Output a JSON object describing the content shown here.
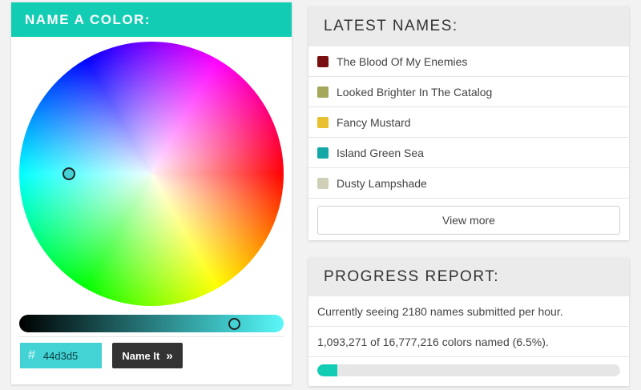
{
  "color_picker": {
    "title": "NAME A COLOR:",
    "hex_symbol": "#",
    "hex_value": "44d3d5",
    "selected_color": "#44d3d5",
    "name_button_label": "Name It",
    "name_button_icon": "double-chevron-right-icon"
  },
  "latest": {
    "title": "LATEST NAMES:",
    "items": [
      {
        "label": "The Blood Of My Enemies",
        "color": "#7a0f12"
      },
      {
        "label": "Looked Brighter In The Catalog",
        "color": "#a3a85a"
      },
      {
        "label": "Fancy Mustard",
        "color": "#e8bf2e"
      },
      {
        "label": "Island Green Sea",
        "color": "#13a8a6"
      },
      {
        "label": "Dusty Lampshade",
        "color": "#d0d0b8"
      }
    ],
    "view_more_label": "View more"
  },
  "progress": {
    "title": "PROGRESS REPORT:",
    "rate_text": "Currently seeing 2180 names submitted per hour.",
    "count_text": "1,093,271 of 16,777,216 colors named (6.5%).",
    "percent": 6.5
  },
  "colors": {
    "accent": "#12cdb3",
    "dark_button": "#333333"
  }
}
